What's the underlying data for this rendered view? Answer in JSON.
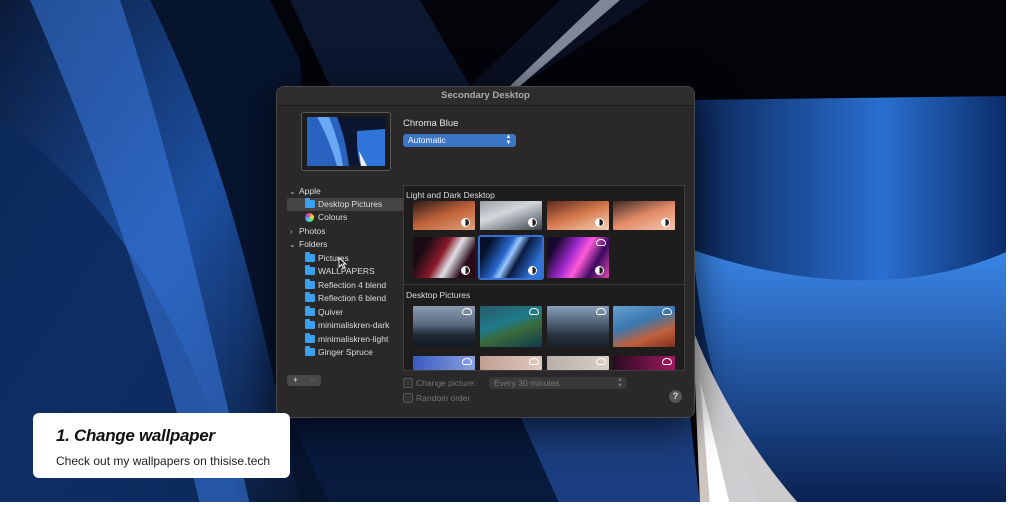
{
  "window": {
    "title": "Secondary Desktop",
    "wallpaper_name": "Chroma Blue",
    "mode_select": "Automatic"
  },
  "sidebar": {
    "apple": {
      "label": "Apple",
      "items": [
        "Desktop Pictures",
        "Colours"
      ]
    },
    "photos": {
      "label": "Photos"
    },
    "folders": {
      "label": "Folders",
      "items": [
        "Pictures",
        "WALLPAPERS",
        "Reflection 4 blend",
        "Reflection 6 blend",
        "Quiver",
        "minimaliskren-dark",
        "minimaliskren-light",
        "Ginger Spruce"
      ]
    },
    "selected": "Desktop Pictures"
  },
  "gallery": {
    "light_dark_heading": "Light and Dark Desktop",
    "desktop_pictures_heading": "Desktop Pictures"
  },
  "footer": {
    "add_label": "+",
    "remove_label": "−",
    "change_picture_label": "Change picture:",
    "interval_value": "Every 30 minutes",
    "random_order_label": "Random order",
    "help_label": "?"
  },
  "caption": {
    "title": "1. Change wallpaper",
    "subtitle": "Check out my wallpapers on thisise.tech"
  },
  "colors": {
    "accent": "#3c76c7",
    "selection_outline": "#3a6fd0",
    "folder_icon": "#3aa0f0"
  }
}
